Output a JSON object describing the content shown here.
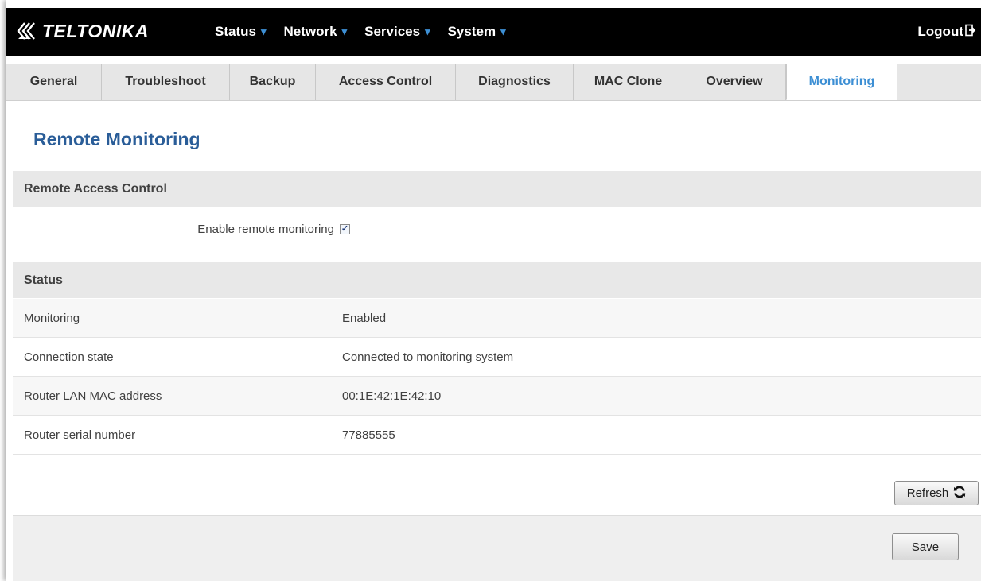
{
  "header": {
    "brand": "TELTONIKA",
    "nav": [
      {
        "label": "Status"
      },
      {
        "label": "Network"
      },
      {
        "label": "Services"
      },
      {
        "label": "System"
      }
    ],
    "logout_label": "Logout"
  },
  "tabs": [
    {
      "label": "General"
    },
    {
      "label": "Troubleshoot"
    },
    {
      "label": "Backup"
    },
    {
      "label": "Access Control"
    },
    {
      "label": "Diagnostics"
    },
    {
      "label": "MAC Clone"
    },
    {
      "label": "Overview"
    },
    {
      "label": "Monitoring"
    }
  ],
  "active_tab": "Monitoring",
  "page": {
    "title": "Remote Monitoring",
    "remote_access": {
      "heading": "Remote Access Control",
      "enable_label": "Enable remote monitoring",
      "enabled": true
    },
    "status": {
      "heading": "Status",
      "rows": [
        {
          "key": "Monitoring",
          "value": "Enabled"
        },
        {
          "key": "Connection state",
          "value": "Connected to monitoring system"
        },
        {
          "key": "Router LAN MAC address",
          "value": "00:1E:42:1E:42:10"
        },
        {
          "key": "Router serial number",
          "value": "77885555"
        }
      ]
    },
    "refresh_label": "Refresh",
    "save_label": "Save"
  },
  "colors": {
    "accent": "#3d8fd4",
    "title": "#2a5d98",
    "topbar": "#000000"
  }
}
